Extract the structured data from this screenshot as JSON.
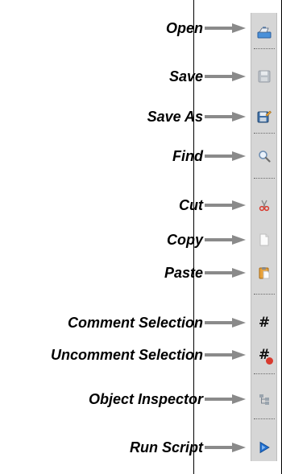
{
  "callouts": {
    "open": "Open",
    "save": "Save",
    "save_as": "Save As",
    "find": "Find",
    "cut": "Cut",
    "copy": "Copy",
    "paste": "Paste",
    "comment_selection": "Comment Selection",
    "uncomment_selection": "Uncomment Selection",
    "object_inspector": "Object Inspector",
    "run_script": "Run Script"
  },
  "toolbar": {
    "buttons": [
      {
        "id": "open",
        "icon": "open-folder-icon"
      },
      {
        "id": "save",
        "icon": "floppy-disk-icon",
        "state": "disabled"
      },
      {
        "id": "save_as",
        "icon": "floppy-disk-pencil-icon"
      },
      {
        "id": "find",
        "icon": "magnifier-icon"
      },
      {
        "id": "cut",
        "icon": "scissors-icon"
      },
      {
        "id": "copy",
        "icon": "copy-page-icon"
      },
      {
        "id": "paste",
        "icon": "clipboard-icon"
      },
      {
        "id": "comment_selection",
        "icon": "hash-icon"
      },
      {
        "id": "uncomment_selection",
        "icon": "hash-remove-icon"
      },
      {
        "id": "object_inspector",
        "icon": "tree-structure-icon"
      },
      {
        "id": "run_script",
        "icon": "play-triangle-icon"
      }
    ]
  },
  "colors": {
    "toolbar_bg": "#d6d6d6",
    "arrow": "#8a8a8a",
    "label_text": "#000000",
    "run_blue": "#1f6fd1",
    "cut_red": "#d83a2e",
    "paste_orange": "#e8a23a"
  }
}
